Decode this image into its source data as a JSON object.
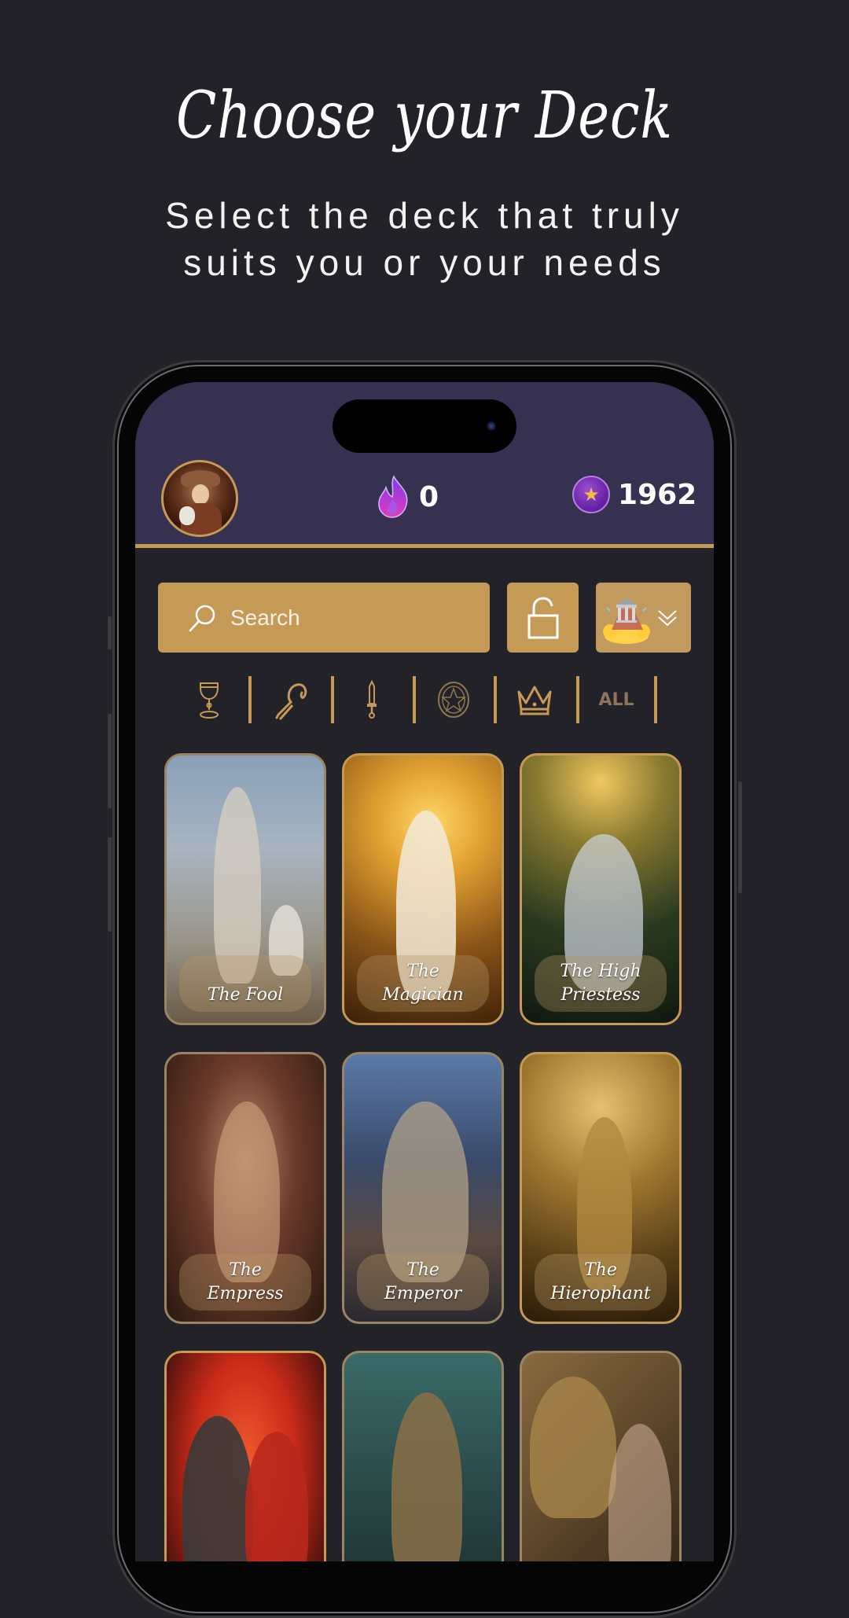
{
  "promo": {
    "title": "Choose your Deck",
    "subtitle": "Select the deck that truly\nsuits you or your needs"
  },
  "header": {
    "streak_icon": "flame-icon",
    "streak_count": "0",
    "coin_icon": "star-coin-icon",
    "coin_count": "1962"
  },
  "toolbar": {
    "search_placeholder": "Search",
    "lock_icon": "unlocked-padlock-icon",
    "deck_icon": "olympus-temple-icon",
    "deck_dropdown_icon": "double-chevron-down-icon"
  },
  "filters": [
    {
      "name": "cups",
      "icon": "chalice-icon"
    },
    {
      "name": "wands",
      "icon": "staff-icon"
    },
    {
      "name": "swords",
      "icon": "sword-icon"
    },
    {
      "name": "pentacles",
      "icon": "pentacle-coin-icon"
    },
    {
      "name": "major-arcana",
      "icon": "crown-icon"
    },
    {
      "name": "all",
      "label": "ALL"
    }
  ],
  "cards": [
    {
      "label": "The Fool",
      "state": "dimmed"
    },
    {
      "label": "The\nMagician",
      "state": "active"
    },
    {
      "label": "The High\nPriestess",
      "state": "active"
    },
    {
      "label": "The\nEmpress",
      "state": "dimmed"
    },
    {
      "label": "The\nEmperor",
      "state": "dimmed"
    },
    {
      "label": "The\nHierophant",
      "state": "active"
    },
    {
      "label": "",
      "state": "active"
    },
    {
      "label": "",
      "state": "dimmed"
    },
    {
      "label": "",
      "state": "dimmed"
    }
  ],
  "colors": {
    "background": "#232228",
    "header": "#363150",
    "gold": "#c59a56",
    "all_label": "#8e7458"
  }
}
